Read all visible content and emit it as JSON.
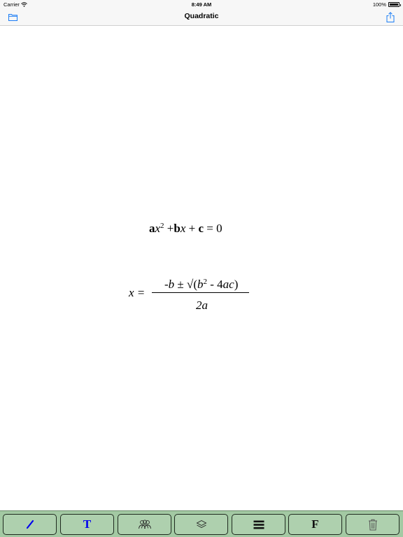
{
  "status_bar": {
    "carrier": "Carrier",
    "time": "8:49 AM",
    "battery": "100%"
  },
  "nav_bar": {
    "title": "Quadratic",
    "left_icon": "folder-icon",
    "right_icon": "share-icon"
  },
  "canvas": {
    "equation1": {
      "a": "a",
      "x": "x",
      "exp": "2",
      "plus_b": " +",
      "b": "b",
      "x2": "x",
      "plus_c": " + ",
      "c": "c",
      "eq_zero": " = 0"
    },
    "equation2": {
      "lhs": "x = ",
      "num_neg": "-",
      "num_b": "b",
      "num_pm_root": " ± √(",
      "num_b2": "b",
      "num_exp": "2",
      "num_minus": " - 4",
      "num_ac": "ac",
      "num_close": ")",
      "den": "2a"
    }
  },
  "toolbar": {
    "buttons": [
      {
        "icon": "line-tool-icon",
        "label": ""
      },
      {
        "icon": "text-tool-icon",
        "label": "T"
      },
      {
        "icon": "group-icon",
        "label": ""
      },
      {
        "icon": "layers-icon",
        "label": ""
      },
      {
        "icon": "menu-icon",
        "label": ""
      },
      {
        "icon": "font-icon",
        "label": "F"
      },
      {
        "icon": "trash-icon",
        "label": ""
      }
    ],
    "accent": "#0000ee",
    "background": "#a3c9a3"
  }
}
